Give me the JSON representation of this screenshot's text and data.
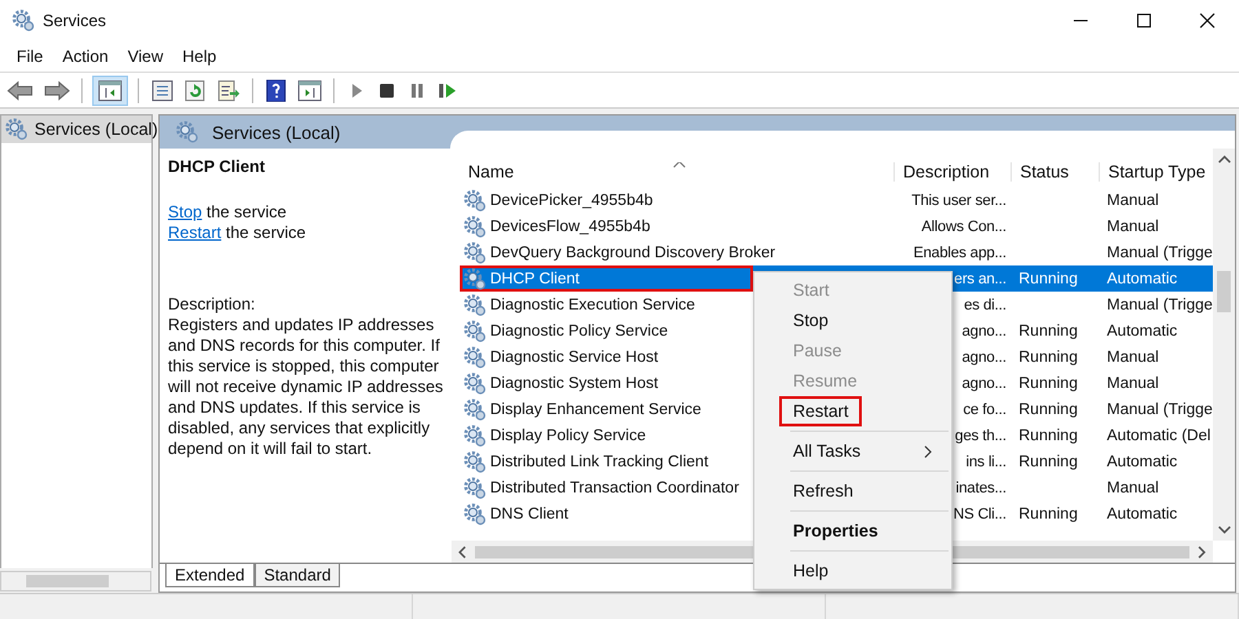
{
  "window": {
    "title": "Services"
  },
  "menu_bar": [
    "File",
    "Action",
    "View",
    "Help"
  ],
  "toolbar": {
    "console_tree_pressed": true
  },
  "tree": {
    "items": [
      {
        "label": "Services (Local)",
        "selected": true
      }
    ]
  },
  "pane_header": "Services (Local)",
  "details": {
    "title": "DHCP Client",
    "actions": [
      {
        "link": "Stop",
        "text": " the service"
      },
      {
        "link": "Restart",
        "text": " the service"
      }
    ],
    "description_label": "Description:",
    "description": "Registers and updates IP addresses and DNS records for this computer. If this service is stopped, this computer will not receive dynamic IP addresses and DNS updates. If this service is disabled, any services that explicitly depend on it will fail to start."
  },
  "table": {
    "columns": [
      "Name",
      "Description",
      "Status",
      "Startup Type"
    ],
    "rows": [
      {
        "name": "DevicePicker_4955b4b",
        "description": "This user ser...",
        "status": "",
        "startup": "Manual",
        "selected": false,
        "annotated": false
      },
      {
        "name": "DevicesFlow_4955b4b",
        "description": "Allows Con...",
        "status": "",
        "startup": "Manual",
        "selected": false,
        "annotated": false
      },
      {
        "name": "DevQuery Background Discovery Broker",
        "description": "Enables app...",
        "status": "",
        "startup": "Manual (Trigge",
        "selected": false,
        "annotated": false
      },
      {
        "name": "DHCP Client",
        "description": "ers an...",
        "status": "Running",
        "startup": "Automatic",
        "selected": true,
        "annotated": true
      },
      {
        "name": "Diagnostic Execution Service",
        "description": "es di...",
        "status": "",
        "startup": "Manual (Trigge",
        "selected": false,
        "annotated": false
      },
      {
        "name": "Diagnostic Policy Service",
        "description": "agno...",
        "status": "Running",
        "startup": "Automatic",
        "selected": false,
        "annotated": false
      },
      {
        "name": "Diagnostic Service Host",
        "description": "agno...",
        "status": "Running",
        "startup": "Manual",
        "selected": false,
        "annotated": false
      },
      {
        "name": "Diagnostic System Host",
        "description": "agno...",
        "status": "Running",
        "startup": "Manual",
        "selected": false,
        "annotated": false
      },
      {
        "name": "Display Enhancement Service",
        "description": "ce fo...",
        "status": "Running",
        "startup": "Manual (Trigge",
        "selected": false,
        "annotated": false
      },
      {
        "name": "Display Policy Service",
        "description": "ges th...",
        "status": "Running",
        "startup": "Automatic (Del",
        "selected": false,
        "annotated": false
      },
      {
        "name": "Distributed Link Tracking Client",
        "description": "ins li...",
        "status": "Running",
        "startup": "Automatic",
        "selected": false,
        "annotated": false
      },
      {
        "name": "Distributed Transaction Coordinator",
        "description": "inates...",
        "status": "",
        "startup": "Manual",
        "selected": false,
        "annotated": false
      },
      {
        "name": "DNS Client",
        "description": "NS Cli...",
        "status": "Running",
        "startup": "Automatic",
        "selected": false,
        "annotated": false
      }
    ]
  },
  "context_menu": [
    {
      "kind": "item",
      "label": "Start",
      "disabled": true,
      "annotated": false
    },
    {
      "kind": "item",
      "label": "Stop",
      "disabled": false,
      "annotated": false
    },
    {
      "kind": "item",
      "label": "Pause",
      "disabled": true,
      "annotated": false
    },
    {
      "kind": "item",
      "label": "Resume",
      "disabled": true,
      "annotated": false
    },
    {
      "kind": "item",
      "label": "Restart",
      "disabled": false,
      "annotated": true
    },
    {
      "kind": "separator"
    },
    {
      "kind": "submenu",
      "label": "All Tasks",
      "disabled": false,
      "annotated": false
    },
    {
      "kind": "separator"
    },
    {
      "kind": "item",
      "label": "Refresh",
      "disabled": false,
      "annotated": false
    },
    {
      "kind": "separator"
    },
    {
      "kind": "default",
      "label": "Properties",
      "disabled": false,
      "annotated": false
    },
    {
      "kind": "separator"
    },
    {
      "kind": "item",
      "label": "Help",
      "disabled": false,
      "annotated": false
    }
  ],
  "view_tabs": [
    {
      "label": "Extended",
      "selected": true
    },
    {
      "label": "Standard",
      "selected": false
    }
  ]
}
